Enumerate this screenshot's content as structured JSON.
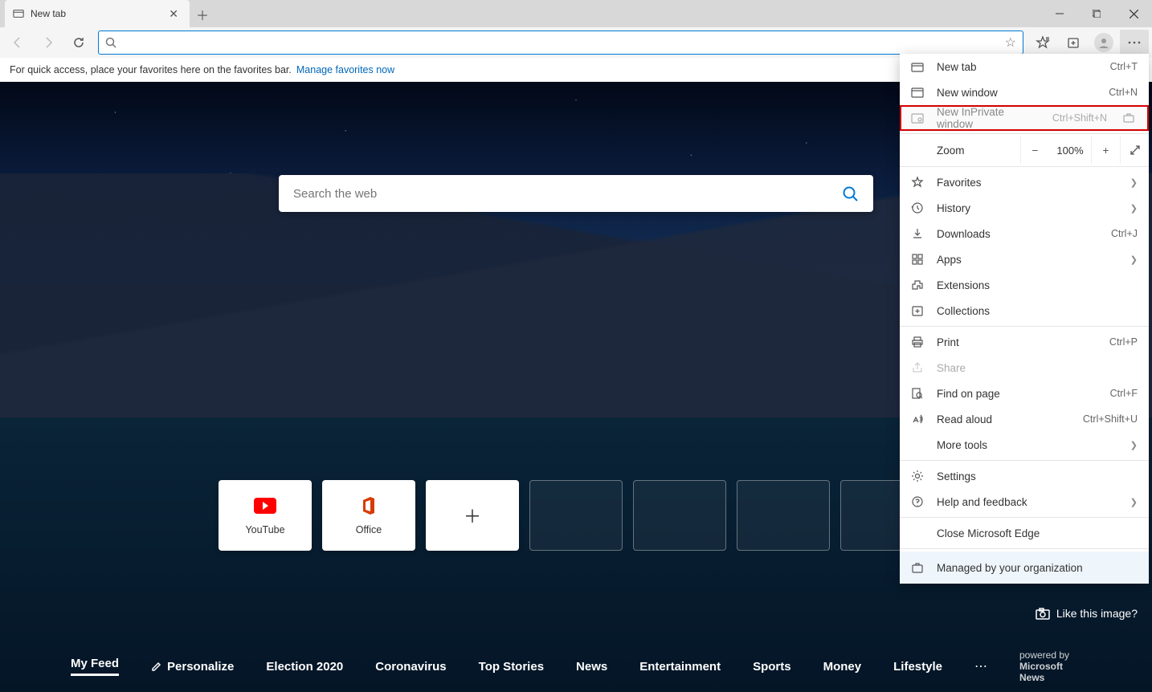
{
  "tab": {
    "title": "New tab"
  },
  "favorites_bar": {
    "hint": "For quick access, place your favorites here on the favorites bar.",
    "manage_link": "Manage favorites now"
  },
  "search": {
    "placeholder": "Search the web"
  },
  "tiles": [
    {
      "label": "YouTube",
      "kind": "youtube"
    },
    {
      "label": "Office",
      "kind": "office"
    },
    {
      "label": "",
      "kind": "add"
    },
    {
      "label": "",
      "kind": "empty"
    },
    {
      "label": "",
      "kind": "empty"
    },
    {
      "label": "",
      "kind": "empty"
    },
    {
      "label": "",
      "kind": "empty"
    }
  ],
  "like_image": "Like this image?",
  "feed": {
    "active": "My Feed",
    "personalize": "Personalize",
    "items": [
      "Election 2020",
      "Coronavirus",
      "Top Stories",
      "News",
      "Entertainment",
      "Sports",
      "Money",
      "Lifestyle"
    ],
    "powered_prefix": "powered by ",
    "powered_brand": "Microsoft News"
  },
  "menu": {
    "new_tab": {
      "label": "New tab",
      "shortcut": "Ctrl+T"
    },
    "new_window": {
      "label": "New window",
      "shortcut": "Ctrl+N"
    },
    "inprivate": {
      "label": "New InPrivate window",
      "shortcut": "Ctrl+Shift+N"
    },
    "zoom": {
      "label": "Zoom",
      "value": "100%"
    },
    "favorites": {
      "label": "Favorites"
    },
    "history": {
      "label": "History"
    },
    "downloads": {
      "label": "Downloads",
      "shortcut": "Ctrl+J"
    },
    "apps": {
      "label": "Apps"
    },
    "extensions": {
      "label": "Extensions"
    },
    "collections": {
      "label": "Collections"
    },
    "print": {
      "label": "Print",
      "shortcut": "Ctrl+P"
    },
    "share": {
      "label": "Share"
    },
    "find": {
      "label": "Find on page",
      "shortcut": "Ctrl+F"
    },
    "read_aloud": {
      "label": "Read aloud",
      "shortcut": "Ctrl+Shift+U"
    },
    "more_tools": {
      "label": "More tools"
    },
    "settings": {
      "label": "Settings"
    },
    "help": {
      "label": "Help and feedback"
    },
    "close_edge": {
      "label": "Close Microsoft Edge"
    },
    "managed": {
      "label": "Managed by your organization"
    }
  }
}
